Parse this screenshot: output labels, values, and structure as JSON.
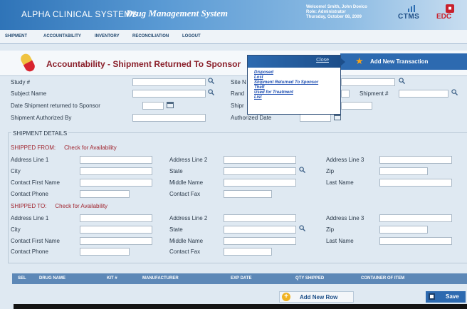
{
  "header": {
    "brand": "ALPHA CLINICAL SYSTEMS",
    "system_name": "Drug Management System",
    "welcome_lines": [
      "Welcome! Smith, John Doeico",
      "Role: Administrator",
      "Thursday, October 08, 2009"
    ],
    "ctms_label": "CTMS",
    "edc_label": "EDC"
  },
  "nav": {
    "items": [
      "SHIPMENT",
      "ACCOUNTABILITY",
      "INVENTORY",
      "RECONCILIATION",
      "LOGOUT"
    ]
  },
  "page": {
    "title": "Accountability - Shipment Returned To Sponsor",
    "add_transaction": "Add New Transaction"
  },
  "popup": {
    "close_label": "Close",
    "items": [
      "Disposed",
      "Lost",
      "Shipment Returned To Sponsor",
      "Theft",
      "Used for Treatment",
      "List"
    ]
  },
  "form": {
    "study_label": "Study #",
    "site_label": "Site N",
    "subject_label": "Subject Name",
    "rand_label": "Rand",
    "shipment_no_label": "Shipment #",
    "date_returned_label": "Date Shipment returned to Sponsor",
    "shipr_label": "Shipr",
    "authorized_by_label": "Shipment Authorized By",
    "authorized_date_label": "Authorized Date"
  },
  "shipment": {
    "section_title": "SHIPMENT DETAILS",
    "from_label": "SHIPPED FROM:",
    "to_label": "SHIPPED TO:",
    "check_label": "Check for Availability",
    "address1": "Address Line 1",
    "address2": "Address Line 2",
    "address3": "Address Line 3",
    "city": "City",
    "state": "State",
    "zip": "Zip",
    "first_name": "Contact First Name",
    "middle_name": "Middle Name",
    "last_name": "Last Name",
    "phone": "Contact Phone",
    "fax": "Contact Fax"
  },
  "grid": {
    "columns": [
      "SEL",
      "DRUG NAME",
      "KIT #",
      "MANUFACTURER",
      "EXP DATE",
      "QTY SHIPPED",
      "CONTAINER OF ITEM"
    ]
  },
  "actions": {
    "add_row": "Add New Row",
    "save": "Save"
  }
}
